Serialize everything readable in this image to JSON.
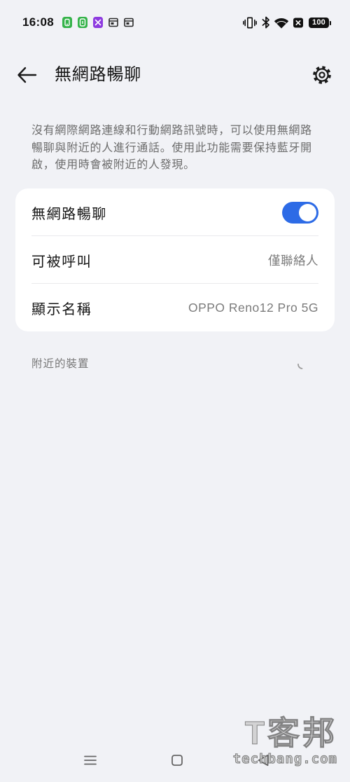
{
  "status_bar": {
    "time": "16:08",
    "notification_icons": [
      {
        "icon": "green-app-icon",
        "color": "#35B34A"
      },
      {
        "icon": "green-app-icon",
        "color": "#35B34A"
      },
      {
        "icon": "purple-app-icon",
        "color": "#8E3BE0"
      },
      {
        "icon": "window-icon",
        "color": "#2A2A2A"
      },
      {
        "icon": "window-icon",
        "color": "#2A2A2A"
      }
    ],
    "system_icons": [
      "vibrate-icon",
      "bluetooth-icon",
      "wifi-icon",
      "no-sim-icon",
      "battery-icon"
    ],
    "battery_level": "100"
  },
  "header": {
    "title": "無網路暢聊",
    "back_icon": "arrow-left-icon",
    "settings_icon": "gear-icon"
  },
  "description": "沒有網際網路連線和行動網路訊號時，可以使用無網路暢聊與附近的人進行通話。使用此功能需要保持藍牙開啟，使用時會被附近的人發現。",
  "settings_card": {
    "offline_chat": {
      "label": "無網路暢聊",
      "enabled": true
    },
    "reachable_by": {
      "label": "可被呼叫",
      "value": "僅聯絡人"
    },
    "display_name": {
      "label": "顯示名稱",
      "value": "OPPO Reno12 Pro 5G"
    }
  },
  "nearby_devices": {
    "label": "附近的裝置",
    "loading": true
  },
  "nav_bar": {
    "icons": [
      "menu-icon",
      "home-icon",
      "back-icon"
    ]
  },
  "colors": {
    "accent": "#2D6BE6",
    "background": "#F1F2F6",
    "card": "#FFFFFF"
  },
  "watermark": {
    "logo": "T客邦",
    "url": "techbang.com"
  }
}
